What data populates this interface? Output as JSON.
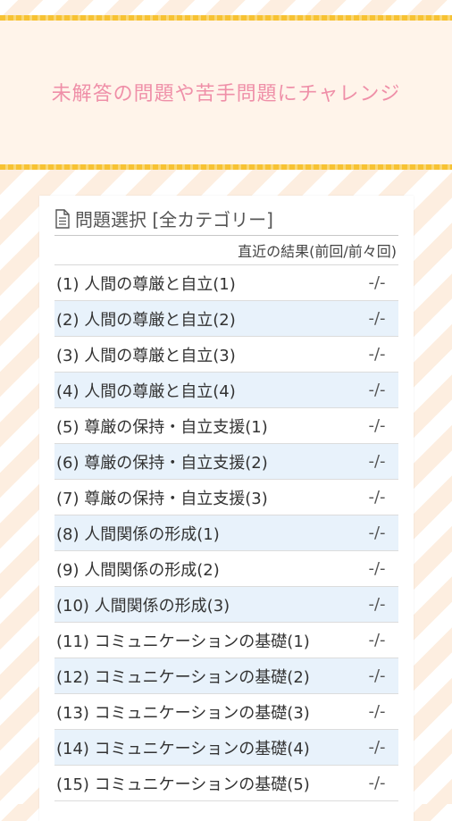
{
  "header": {
    "title": "未解答の問題や苦手問題にチャレンジ"
  },
  "panel": {
    "title": "問題選択 [全カテゴリー]",
    "title_icon": "document-icon",
    "subheader": "直近の結果(前回/前々回)"
  },
  "questions": [
    {
      "label": "(1) 人間の尊厳と自立(1)",
      "result": "-/-"
    },
    {
      "label": "(2) 人間の尊厳と自立(2)",
      "result": "-/-"
    },
    {
      "label": "(3) 人間の尊厳と自立(3)",
      "result": "-/-"
    },
    {
      "label": "(4) 人間の尊厳と自立(4)",
      "result": "-/-"
    },
    {
      "label": "(5) 尊厳の保持・自立支援(1)",
      "result": "-/-"
    },
    {
      "label": "(6) 尊厳の保持・自立支援(2)",
      "result": "-/-"
    },
    {
      "label": "(7) 尊厳の保持・自立支援(3)",
      "result": "-/-"
    },
    {
      "label": "(8) 人間関係の形成(1)",
      "result": "-/-"
    },
    {
      "label": "(9) 人間関係の形成(2)",
      "result": "-/-"
    },
    {
      "label": "(10) 人間関係の形成(3)",
      "result": "-/-"
    },
    {
      "label": "(11) コミュニケーションの基礎(1)",
      "result": "-/-"
    },
    {
      "label": "(12) コミュニケーションの基礎(2)",
      "result": "-/-"
    },
    {
      "label": "(13) コミュニケーションの基礎(3)",
      "result": "-/-"
    },
    {
      "label": "(14) コミュニケーションの基礎(4)",
      "result": "-/-"
    },
    {
      "label": "(15) コミュニケーションの基礎(5)",
      "result": "-/-"
    }
  ],
  "colors": {
    "title_pink": "#ef8fa8",
    "header_bg": "#fff4ea",
    "stripe_gold": "#f7c233",
    "row_alt": "#e8f2fb"
  }
}
